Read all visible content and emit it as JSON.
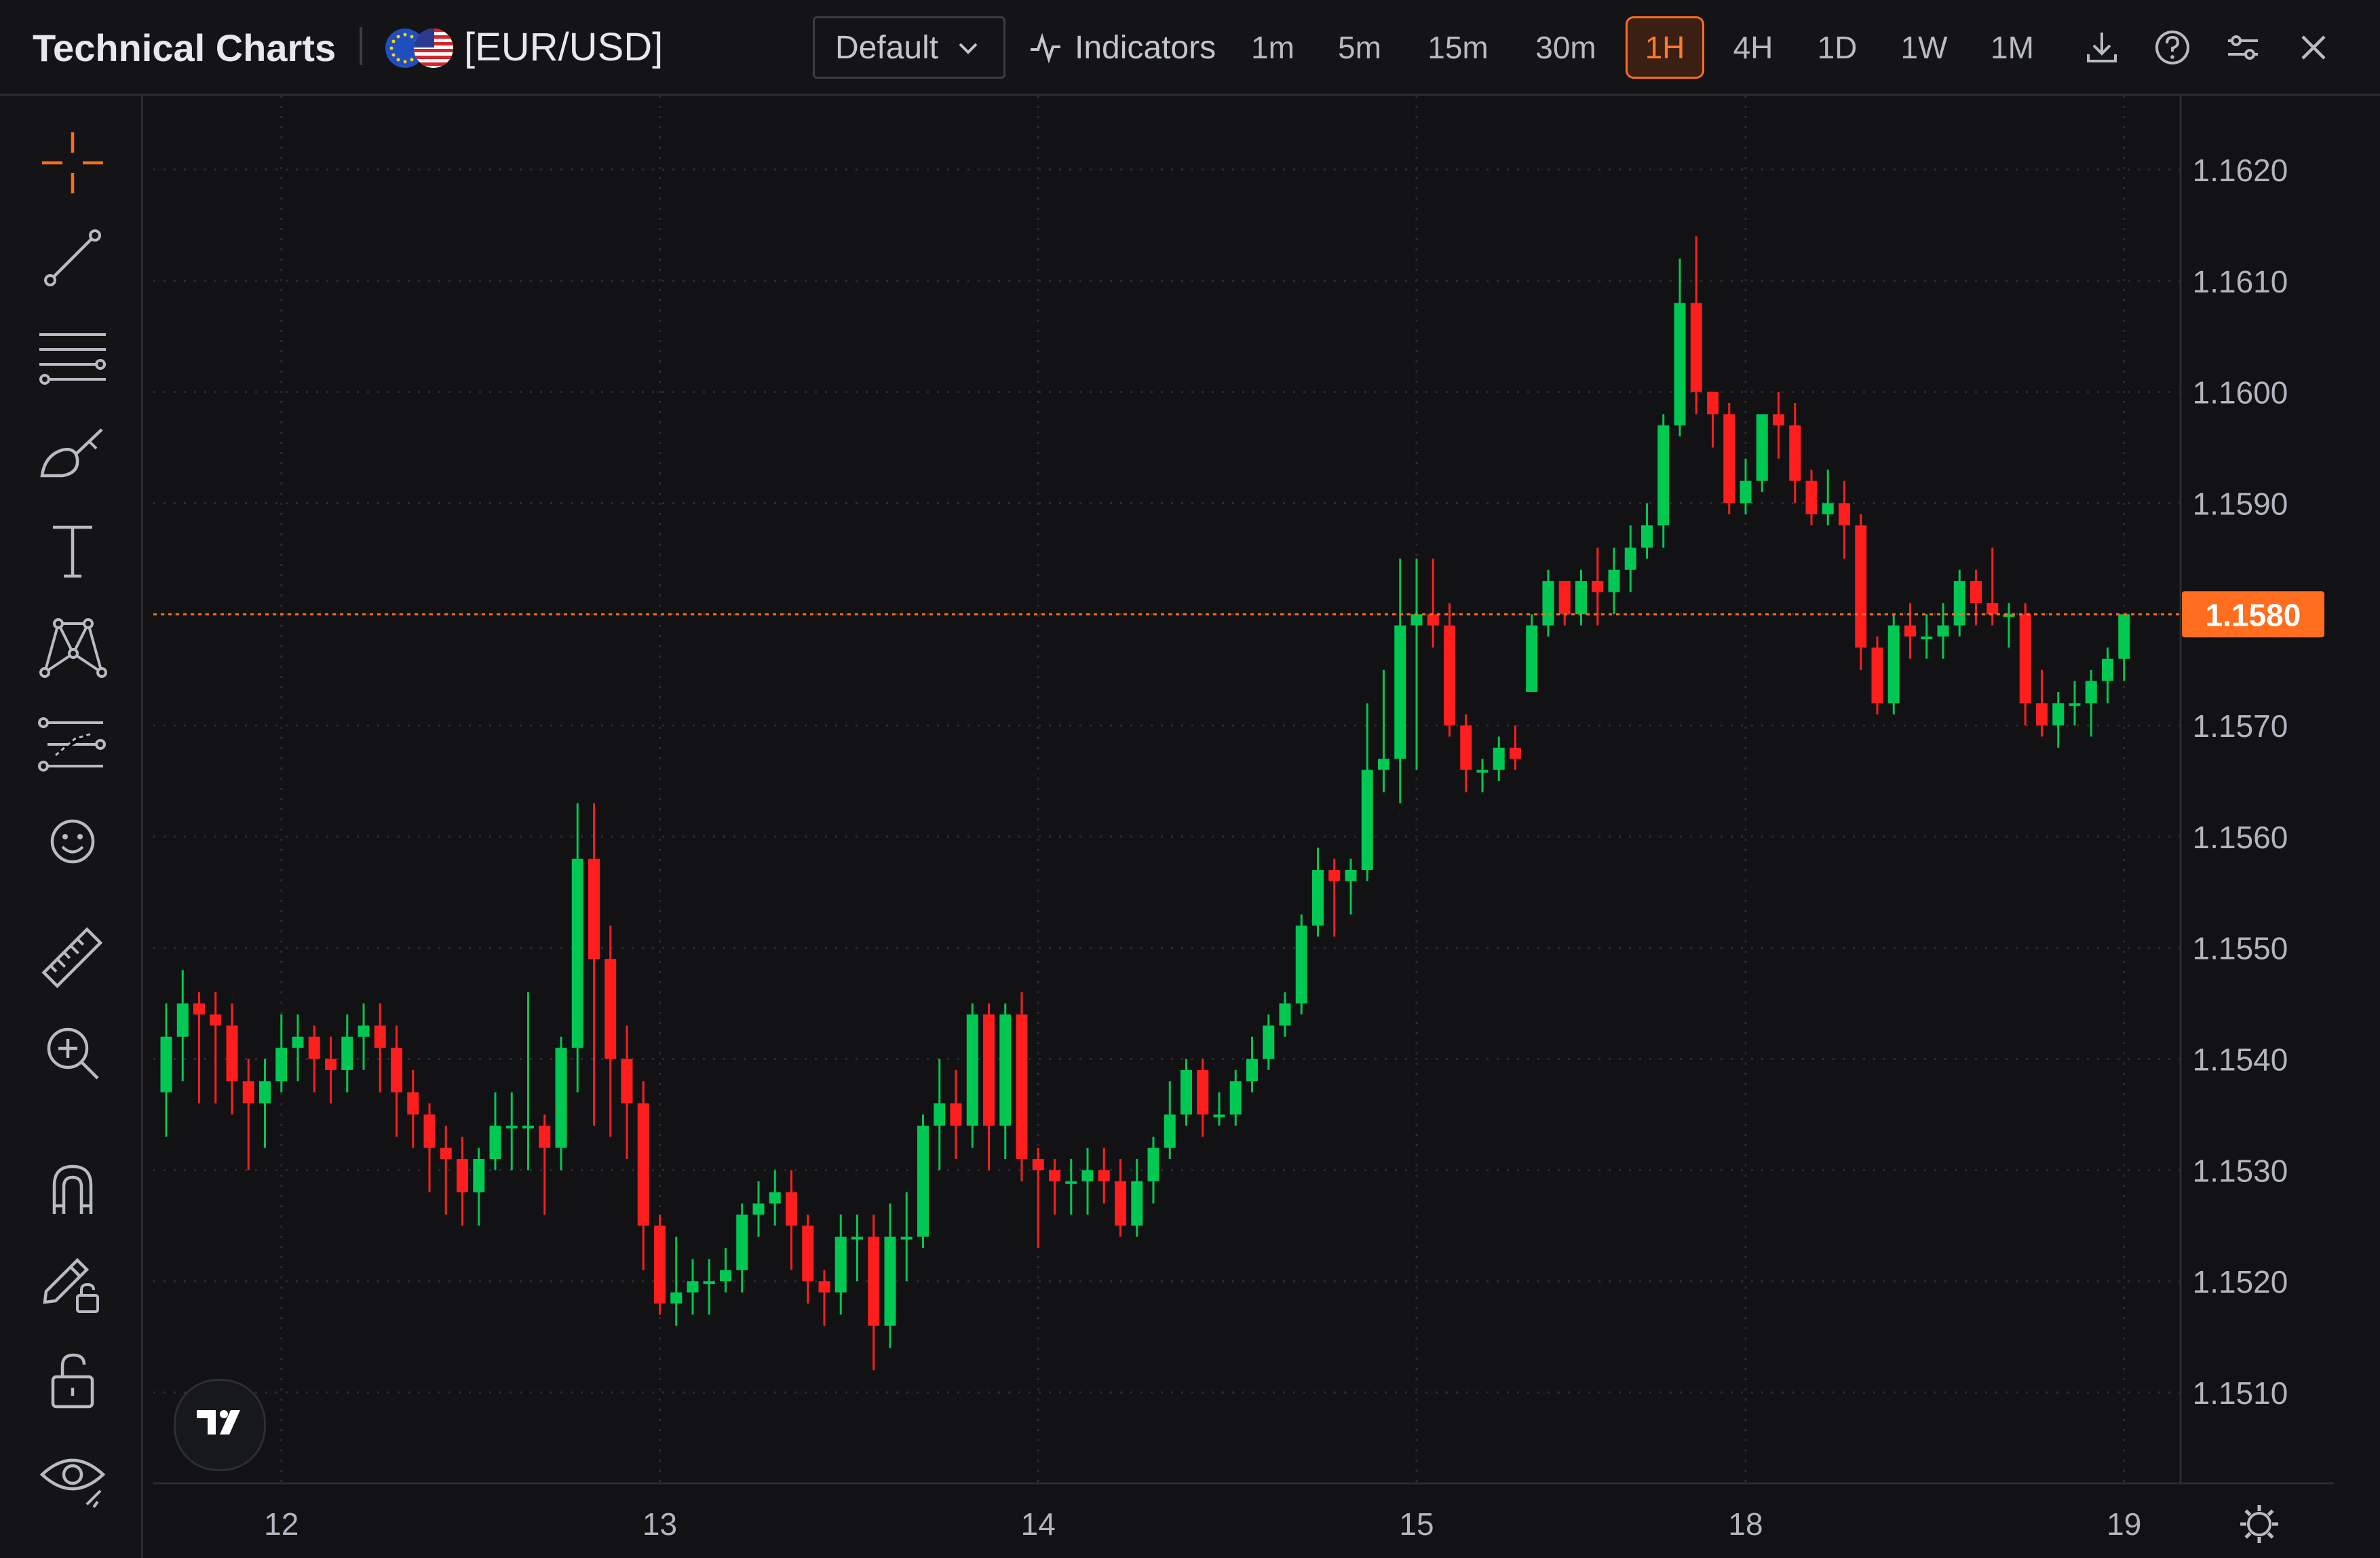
{
  "header": {
    "app_title": "Technical Charts",
    "symbol": "[EUR/USD]",
    "layout_label": "Default",
    "indicators_label": "Indicators",
    "timeframes": [
      {
        "label": "1m",
        "active": false
      },
      {
        "label": "5m",
        "active": false
      },
      {
        "label": "15m",
        "active": false
      },
      {
        "label": "30m",
        "active": false
      },
      {
        "label": "1H",
        "active": true
      },
      {
        "label": "4H",
        "active": false
      },
      {
        "label": "1D",
        "active": false
      },
      {
        "label": "1W",
        "active": false
      },
      {
        "label": "1M",
        "active": false
      }
    ],
    "icons": [
      "download-icon",
      "help-icon",
      "settings-sliders-icon",
      "close-icon"
    ]
  },
  "sidebar": {
    "tools": [
      "crosshair-icon",
      "trend-line-icon",
      "horizontal-lines-icon",
      "brush-icon",
      "text-icon",
      "pattern-icon",
      "forecast-icon",
      "emoji-icon",
      "ruler-icon",
      "zoom-in-icon",
      "magnet-icon",
      "lock-drawing-icon",
      "unlock-icon",
      "eye-icon"
    ]
  },
  "colors": {
    "background": "#121214",
    "up": "#00c853",
    "down": "#ff1e1e",
    "accent": "#ff6d1f",
    "grid": "#2a2c31",
    "text": "#b2b5be"
  },
  "chart_data": {
    "type": "candlestick",
    "price_ticks": [
      "1.1620",
      "1.1610",
      "1.1600",
      "1.1590",
      "1.1580",
      "1.1570",
      "1.1560",
      "1.1550",
      "1.1540",
      "1.1530",
      "1.1520",
      "1.1510"
    ],
    "x_ticks": [
      "12",
      "13",
      "14",
      "15",
      "18",
      "19"
    ],
    "ylim": [
      1.1501,
      1.1633
    ],
    "current_price": "1.1580",
    "x_tick_index": [
      7,
      30,
      53,
      76,
      96,
      119
    ],
    "candles": [
      [
        1.1537,
        1.1542,
        1.1533,
        1.1545
      ],
      [
        1.1542,
        1.1545,
        1.1538,
        1.1548
      ],
      [
        1.1545,
        1.1544,
        1.1536,
        1.1546
      ],
      [
        1.1544,
        1.1543,
        1.1536,
        1.1546
      ],
      [
        1.1543,
        1.1538,
        1.1535,
        1.1545
      ],
      [
        1.1538,
        1.1536,
        1.153,
        1.154
      ],
      [
        1.1536,
        1.1538,
        1.1532,
        1.154
      ],
      [
        1.1538,
        1.1541,
        1.1537,
        1.1544
      ],
      [
        1.1541,
        1.1542,
        1.1538,
        1.1544
      ],
      [
        1.1542,
        1.154,
        1.1537,
        1.1543
      ],
      [
        1.154,
        1.1539,
        1.1536,
        1.1542
      ],
      [
        1.1539,
        1.1542,
        1.1537,
        1.1544
      ],
      [
        1.1542,
        1.1543,
        1.1539,
        1.1545
      ],
      [
        1.1543,
        1.1541,
        1.1537,
        1.1545
      ],
      [
        1.1541,
        1.1537,
        1.1533,
        1.1543
      ],
      [
        1.1537,
        1.1535,
        1.1532,
        1.1539
      ],
      [
        1.1535,
        1.1532,
        1.1528,
        1.1536
      ],
      [
        1.1532,
        1.1531,
        1.1526,
        1.1534
      ],
      [
        1.1531,
        1.1528,
        1.1525,
        1.1533
      ],
      [
        1.1528,
        1.1531,
        1.1525,
        1.1532
      ],
      [
        1.1531,
        1.1534,
        1.153,
        1.1537
      ],
      [
        1.1534,
        1.1534,
        1.153,
        1.1537
      ],
      [
        1.1534,
        1.1534,
        1.153,
        1.1546
      ],
      [
        1.1534,
        1.1532,
        1.1526,
        1.1535
      ],
      [
        1.1532,
        1.1541,
        1.153,
        1.1542
      ],
      [
        1.1541,
        1.1558,
        1.1537,
        1.1563
      ],
      [
        1.1558,
        1.1549,
        1.1534,
        1.1563
      ],
      [
        1.1549,
        1.154,
        1.1533,
        1.1552
      ],
      [
        1.154,
        1.1536,
        1.1531,
        1.1543
      ],
      [
        1.1536,
        1.1525,
        1.1521,
        1.1538
      ],
      [
        1.1525,
        1.1518,
        1.1517,
        1.1526
      ],
      [
        1.1518,
        1.1519,
        1.1516,
        1.1524
      ],
      [
        1.1519,
        1.152,
        1.1517,
        1.1522
      ],
      [
        1.152,
        1.152,
        1.1517,
        1.1522
      ],
      [
        1.152,
        1.1521,
        1.1519,
        1.1523
      ],
      [
        1.1521,
        1.1526,
        1.1519,
        1.1527
      ],
      [
        1.1526,
        1.1527,
        1.1524,
        1.1529
      ],
      [
        1.1527,
        1.1528,
        1.1525,
        1.153
      ],
      [
        1.1528,
        1.1525,
        1.1521,
        1.153
      ],
      [
        1.1525,
        1.152,
        1.1518,
        1.1526
      ],
      [
        1.152,
        1.1519,
        1.1516,
        1.1521
      ],
      [
        1.1519,
        1.1524,
        1.1517,
        1.1526
      ],
      [
        1.1524,
        1.1524,
        1.152,
        1.1526
      ],
      [
        1.1524,
        1.1516,
        1.1512,
        1.1526
      ],
      [
        1.1516,
        1.1524,
        1.1514,
        1.1527
      ],
      [
        1.1524,
        1.1524,
        1.152,
        1.1528
      ],
      [
        1.1524,
        1.1534,
        1.1523,
        1.1535
      ],
      [
        1.1534,
        1.1536,
        1.153,
        1.154
      ],
      [
        1.1536,
        1.1534,
        1.1531,
        1.1539
      ],
      [
        1.1534,
        1.1544,
        1.1532,
        1.1545
      ],
      [
        1.1544,
        1.1534,
        1.153,
        1.1545
      ],
      [
        1.1534,
        1.1544,
        1.1531,
        1.1545
      ],
      [
        1.1544,
        1.1531,
        1.1529,
        1.1546
      ],
      [
        1.1531,
        1.153,
        1.1523,
        1.1532
      ],
      [
        1.153,
        1.1529,
        1.1526,
        1.1531
      ],
      [
        1.1529,
        1.1529,
        1.1526,
        1.1531
      ],
      [
        1.1529,
        1.153,
        1.1526,
        1.1532
      ],
      [
        1.153,
        1.1529,
        1.1527,
        1.1532
      ],
      [
        1.1529,
        1.1525,
        1.1524,
        1.1531
      ],
      [
        1.1525,
        1.1529,
        1.1524,
        1.1531
      ],
      [
        1.1529,
        1.1532,
        1.1527,
        1.1533
      ],
      [
        1.1532,
        1.1535,
        1.1531,
        1.1538
      ],
      [
        1.1535,
        1.1539,
        1.1534,
        1.154
      ],
      [
        1.1539,
        1.1535,
        1.1533,
        1.154
      ],
      [
        1.1535,
        1.1535,
        1.1534,
        1.1537
      ],
      [
        1.1535,
        1.1538,
        1.1534,
        1.1539
      ],
      [
        1.1538,
        1.154,
        1.1537,
        1.1542
      ],
      [
        1.154,
        1.1543,
        1.1539,
        1.1544
      ],
      [
        1.1543,
        1.1545,
        1.1542,
        1.1546
      ],
      [
        1.1545,
        1.1552,
        1.1544,
        1.1553
      ],
      [
        1.1552,
        1.1557,
        1.1551,
        1.1559
      ],
      [
        1.1557,
        1.1556,
        1.1551,
        1.1558
      ],
      [
        1.1556,
        1.1557,
        1.1553,
        1.1558
      ],
      [
        1.1557,
        1.1566,
        1.1556,
        1.1572
      ],
      [
        1.1566,
        1.1567,
        1.1564,
        1.1575
      ],
      [
        1.1567,
        1.1579,
        1.1563,
        1.1585
      ],
      [
        1.1579,
        1.158,
        1.1566,
        1.1585
      ],
      [
        1.158,
        1.1579,
        1.1577,
        1.1585
      ],
      [
        1.1579,
        1.157,
        1.1569,
        1.1581
      ],
      [
        1.157,
        1.1566,
        1.1564,
        1.1571
      ],
      [
        1.1566,
        1.1566,
        1.1564,
        1.1567
      ],
      [
        1.1566,
        1.1568,
        1.1565,
        1.1569
      ],
      [
        1.1568,
        1.1567,
        1.1566,
        1.157
      ],
      [
        1.1573,
        1.1579,
        1.1573,
        1.158
      ],
      [
        1.1579,
        1.1583,
        1.1578,
        1.1584
      ],
      [
        1.1583,
        1.158,
        1.1579,
        1.1583
      ],
      [
        1.158,
        1.1583,
        1.1579,
        1.1584
      ],
      [
        1.1583,
        1.1582,
        1.1579,
        1.1586
      ],
      [
        1.1582,
        1.1584,
        1.158,
        1.1586
      ],
      [
        1.1584,
        1.1586,
        1.1582,
        1.1588
      ],
      [
        1.1586,
        1.1588,
        1.1585,
        1.159
      ],
      [
        1.1588,
        1.1597,
        1.1586,
        1.1598
      ],
      [
        1.1597,
        1.1608,
        1.1596,
        1.1612
      ],
      [
        1.1608,
        1.16,
        1.1598,
        1.1614
      ],
      [
        1.16,
        1.1598,
        1.1595,
        1.16
      ],
      [
        1.1598,
        1.159,
        1.1589,
        1.1599
      ],
      [
        1.159,
        1.1592,
        1.1589,
        1.1594
      ],
      [
        1.1592,
        1.1598,
        1.1591,
        1.1598
      ],
      [
        1.1598,
        1.1597,
        1.1594,
        1.16
      ],
      [
        1.1597,
        1.1592,
        1.159,
        1.1599
      ],
      [
        1.1592,
        1.1589,
        1.1588,
        1.1593
      ],
      [
        1.1589,
        1.159,
        1.1588,
        1.1593
      ],
      [
        1.159,
        1.1588,
        1.1585,
        1.1592
      ],
      [
        1.1588,
        1.1577,
        1.1575,
        1.1589
      ],
      [
        1.1577,
        1.1572,
        1.1571,
        1.1578
      ],
      [
        1.1572,
        1.1579,
        1.1571,
        1.158
      ],
      [
        1.1579,
        1.1578,
        1.1576,
        1.1581
      ],
      [
        1.1578,
        1.1578,
        1.1576,
        1.158
      ],
      [
        1.1578,
        1.1579,
        1.1576,
        1.1581
      ],
      [
        1.1579,
        1.1583,
        1.1578,
        1.1584
      ],
      [
        1.1583,
        1.1581,
        1.1579,
        1.1584
      ],
      [
        1.1581,
        1.158,
        1.1579,
        1.1586
      ],
      [
        1.158,
        1.158,
        1.1577,
        1.1581
      ],
      [
        1.158,
        1.1572,
        1.157,
        1.1581
      ],
      [
        1.1572,
        1.157,
        1.1569,
        1.1575
      ],
      [
        1.157,
        1.1572,
        1.1568,
        1.1573
      ],
      [
        1.1572,
        1.1572,
        1.157,
        1.1574
      ],
      [
        1.1572,
        1.1574,
        1.1569,
        1.1575
      ],
      [
        1.1574,
        1.1576,
        1.1572,
        1.1577
      ],
      [
        1.1576,
        1.158,
        1.1574,
        1.158
      ]
    ]
  }
}
